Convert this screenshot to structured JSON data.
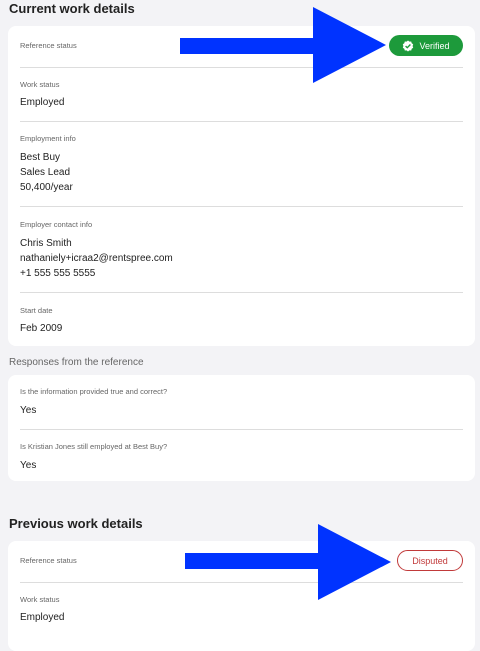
{
  "current": {
    "title": "Current work details",
    "reference_status_label": "Reference status",
    "reference_status_value": "Verified",
    "work_status_label": "Work status",
    "work_status_value": "Employed",
    "employment_info_label": "Employment info",
    "employer": "Best Buy",
    "position": "Sales Lead",
    "salary": "50,400/year",
    "employer_contact_label": "Employer contact info",
    "contact_name": "Chris Smith",
    "contact_email": "nathaniely+icraa2@rentspree.com",
    "contact_phone": "+1 555 555 5555",
    "start_date_label": "Start date",
    "start_date_value": "Feb 2009"
  },
  "responses": {
    "title": "Responses from the reference",
    "q1_label": "Is the information provided true and correct?",
    "q1_value": "Yes",
    "q2_label": "Is Kristian Jones still employed at Best Buy?",
    "q2_value": "Yes"
  },
  "previous": {
    "title": "Previous work details",
    "reference_status_label": "Reference status",
    "reference_status_value": "Disputed",
    "work_status_label": "Work status",
    "work_status_value": "Employed"
  },
  "colors": {
    "verified": "#1d9a3b",
    "disputed": "#c13a3a",
    "arrow": "#0033ff"
  }
}
